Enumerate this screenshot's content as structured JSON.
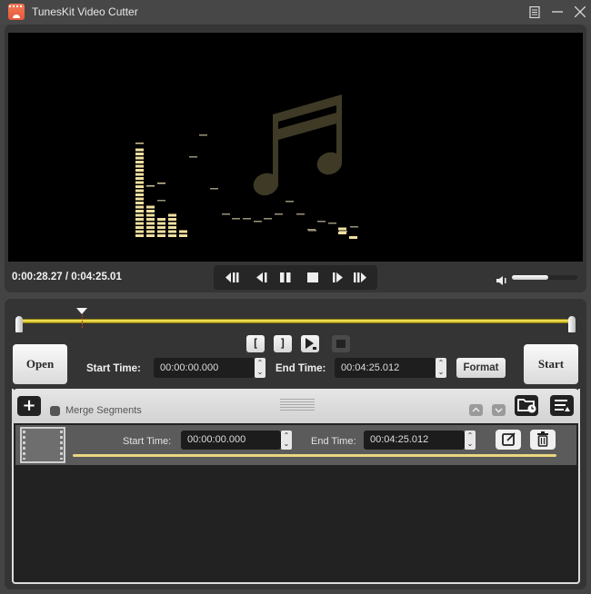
{
  "app": {
    "title": "TunesKit Video Cutter",
    "icon": "film-clapper-icon"
  },
  "window_controls": {
    "menu": "menu-icon",
    "minimize": "minimize-icon",
    "close": "close-icon"
  },
  "player": {
    "current_time": "0:00:28.27",
    "separator": " / ",
    "total_time": "0:04:25.01",
    "time_display": "0:00:28.27 / 0:04:25.01",
    "transport_buttons": [
      {
        "name": "previous-segment",
        "icon": "skip-back-icon"
      },
      {
        "name": "previous-frame",
        "icon": "step-back-icon"
      },
      {
        "name": "pause",
        "icon": "pause-icon"
      },
      {
        "name": "stop",
        "icon": "stop-icon"
      },
      {
        "name": "next-frame",
        "icon": "step-forward-icon"
      },
      {
        "name": "next-segment",
        "icon": "skip-forward-icon"
      }
    ],
    "volume_percent": 55,
    "playback_position_fraction": 0.111
  },
  "editor": {
    "mark_in_label": "[",
    "mark_out_label": "]",
    "preview_segment": "play-segment-icon",
    "stop_preview": "stop-icon",
    "open_label": "Open",
    "start_time_label": "Start Time:",
    "start_time_value": "00:00:00.000",
    "end_time_label": "End Time:",
    "end_time_value": "00:04:25.012",
    "format_label": "Format",
    "start_label": "Start"
  },
  "segments_panel": {
    "add_label": "+",
    "merge_label": "Merge Segments",
    "merge_checked": false,
    "move_up": "^",
    "move_down": "v",
    "output_folder": "folder-clock-icon",
    "list_menu": "list-icon",
    "segments": [
      {
        "start_label": "Start Time:",
        "start_value": "00:00:00.000",
        "end_label": "End Time:",
        "end_value": "00:04:25.012",
        "edit_icon": "edit-icon",
        "delete_icon": "trash-icon"
      }
    ]
  },
  "colors": {
    "accent_yellow": "#e8d44a",
    "window_bg": "#444444",
    "panel_bg": "#343434",
    "video_bg": "#000000"
  }
}
